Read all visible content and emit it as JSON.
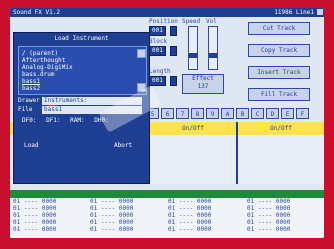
{
  "window": {
    "title": "Sound FX V1.2",
    "status": "11986 Line1",
    "status_icon": "window-close-icon"
  },
  "controls": {
    "position_label": "Position",
    "position_value": "001",
    "block_label": "Block",
    "block_value": "001",
    "length_label": "Length",
    "length_value": "001",
    "speed_label": "Speed",
    "vol_label": "Vol",
    "speed_level": 0.3,
    "vol_level": 0.3,
    "effect_label": "Effect",
    "effect_value": "137"
  },
  "track_buttons": [
    "Cut Track",
    "Copy Track",
    "Insert Track",
    "Fill Track"
  ],
  "channel_digits": [
    "5",
    "6",
    "7",
    "8",
    "9",
    "A",
    "B",
    "C",
    "D",
    "E",
    "F"
  ],
  "channels": [
    "On/Off",
    "On/Off",
    "On/Off"
  ],
  "dialog": {
    "title": "Load Instrument",
    "items": [
      "/ (parent)",
      "Afterthought",
      "Analog-DigiMix",
      "bass.drum",
      "bass1",
      "bass2"
    ],
    "selected_index": 4,
    "drawer_label": "Drawer",
    "drawer_value": "Instruments:",
    "file_label": "File",
    "file_value": "bass1",
    "stat_df0": "DF0:",
    "stat_df1": "DF1:",
    "stat_ram": "RAM:",
    "stat_dh0": "DH0:",
    "load_label": "Load",
    "abort_label": "Abort"
  },
  "pattern_rows": [
    [
      "01",
      "0000"
    ],
    [
      "01",
      "0000"
    ],
    [
      "01",
      "0000"
    ],
    [
      "01",
      "0000"
    ],
    [
      "01",
      "0000"
    ]
  ],
  "colors": {
    "frame": "#c8102e",
    "screen": "#dfe7f3",
    "accent": "#1f3f93",
    "highlight": "#ffe34a",
    "bar": "#1e8a3a"
  }
}
